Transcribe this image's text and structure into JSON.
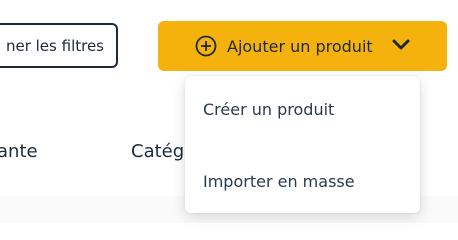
{
  "toolbar": {
    "filter_button_label": "ner les filtres",
    "add_product_label": "Ajouter un produit",
    "add_icon": "plus-circle-icon",
    "dropdown_icon": "chevron-down-icon",
    "accent_color": "#f6b20c"
  },
  "table": {
    "columns": [
      "ante",
      "Catég"
    ]
  },
  "dropdown_menu": {
    "items": [
      {
        "label": "Créer un produit"
      },
      {
        "label": "Importer en masse"
      }
    ]
  }
}
